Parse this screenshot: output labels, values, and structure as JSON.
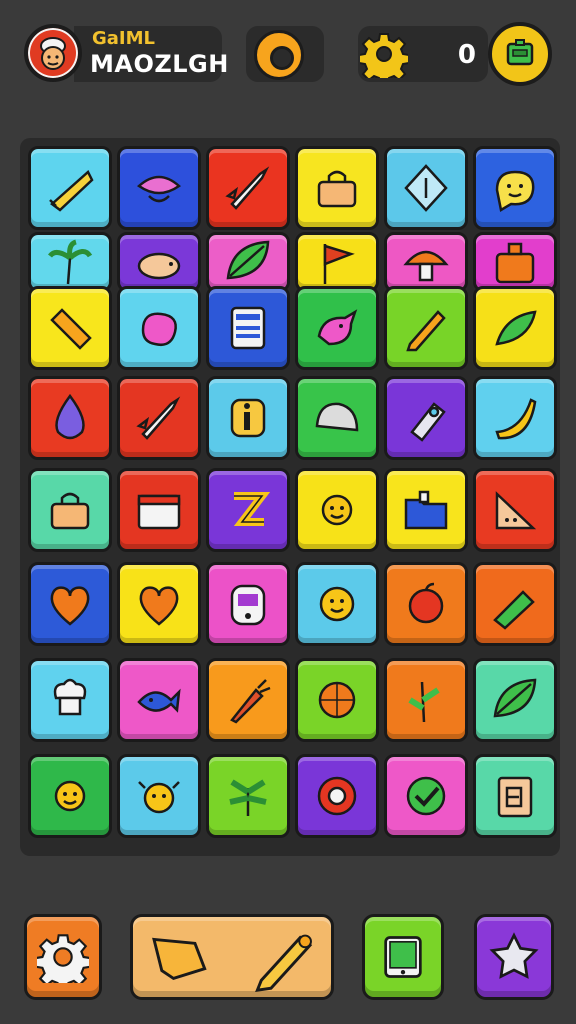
{
  "player": {
    "title": "GaIML",
    "name": "MAOZLGH"
  },
  "score": {
    "value": "0"
  },
  "icons": {
    "avatar": "chef-avatar-icon",
    "ring": "ring-coin-icon",
    "gear": "gear-icon",
    "menu": "menu-box-icon"
  },
  "board": {
    "rows": [
      [
        {
          "icon": "cheese-icon",
          "color": "#5ed4ee"
        },
        {
          "icon": "pink-hat-icon",
          "color": "#2d50dc"
        },
        {
          "icon": "rocket-icon",
          "color": "#ea3420"
        },
        {
          "icon": "lock-bag-icon",
          "color": "#f7e520"
        },
        {
          "icon": "gem-icon",
          "color": "#5cc8ea"
        },
        {
          "icon": "smiley-blob-icon",
          "color": "#2d62e0"
        }
      ],
      [
        {
          "icon": "palm-tree-icon",
          "color": "#62d8ec"
        },
        {
          "icon": "pig-icon",
          "color": "#7b38d8"
        },
        {
          "icon": "leaf-icon",
          "color": "#ec5ec8"
        },
        {
          "icon": "flag-icon",
          "color": "#f7e018"
        },
        {
          "icon": "mushroom-icon",
          "color": "#ee58c4"
        },
        {
          "icon": "bag-icon",
          "color": "#e23ecc"
        }
      ],
      [
        {
          "icon": "ruler-icon",
          "color": "#f8e61c"
        },
        {
          "icon": "bean-icon",
          "color": "#60d4ee"
        },
        {
          "icon": "calculator-icon",
          "color": "#2d58d8"
        },
        {
          "icon": "bird-icon",
          "color": "#30c04a"
        },
        {
          "icon": "pencil-icon",
          "color": "#78d428"
        },
        {
          "icon": "green-leaf-icon",
          "color": "#f6e018"
        }
      ],
      [
        {
          "icon": "drop-icon",
          "color": "#e83a22"
        },
        {
          "icon": "rocket-icon",
          "color": "#e43622"
        },
        {
          "icon": "info-icon",
          "color": "#5ccaea"
        },
        {
          "icon": "shell-icon",
          "color": "#38c44a"
        },
        {
          "icon": "bottle-icon",
          "color": "#7a36d8"
        },
        {
          "icon": "banana-icon",
          "color": "#60d0ee"
        }
      ],
      [
        {
          "icon": "lock-bag-icon",
          "color": "#58d8a8"
        },
        {
          "icon": "calendar-icon",
          "color": "#e43622"
        },
        {
          "icon": "letter-z-icon",
          "color": "#7a36d8"
        },
        {
          "icon": "sun-face-icon",
          "color": "#f7e218"
        },
        {
          "icon": "folder-icon",
          "color": "#f8e41c"
        },
        {
          "icon": "triangle-ruler-icon",
          "color": "#e83a22"
        }
      ],
      [
        {
          "icon": "heart-icon",
          "color": "#2d5ad8"
        },
        {
          "icon": "heart-icon",
          "color": "#f8e218"
        },
        {
          "icon": "robot-icon",
          "color": "#ec52c8"
        },
        {
          "icon": "smiley-icon",
          "color": "#5ccaea"
        },
        {
          "icon": "apple-icon",
          "color": "#f07a1c"
        },
        {
          "icon": "pen-box-icon",
          "color": "#f06a1c"
        }
      ],
      [
        {
          "icon": "chef-hat-icon",
          "color": "#60d2ee"
        },
        {
          "icon": "fish-icon",
          "color": "#ee58c8"
        },
        {
          "icon": "carrot-icon",
          "color": "#f89a1c"
        },
        {
          "icon": "ball-icon",
          "color": "#7ad428"
        },
        {
          "icon": "plant-icon",
          "color": "#f07a1c"
        },
        {
          "icon": "leaf-icon",
          "color": "#58d8a8"
        }
      ],
      [
        {
          "icon": "sun-face-icon",
          "color": "#2fb84a"
        },
        {
          "icon": "bug-icon",
          "color": "#5ccaea"
        },
        {
          "icon": "palm-leaf-icon",
          "color": "#7ad428"
        },
        {
          "icon": "flower-icon",
          "color": "#7a36d8"
        },
        {
          "icon": "check-icon",
          "color": "#ee58c8"
        },
        {
          "icon": "clipboard-icon",
          "color": "#58d8a8"
        }
      ]
    ]
  },
  "bottom": {
    "settings": {
      "icon": "gear-icon",
      "color": "#ef7c24"
    },
    "tools": {
      "icon": "shovel-pencil-icon",
      "color": "#f3b96a"
    },
    "tablet": {
      "icon": "tablet-icon",
      "color": "#7ad428"
    },
    "star": {
      "icon": "star-badge-icon",
      "color": "#8a38d8"
    }
  }
}
